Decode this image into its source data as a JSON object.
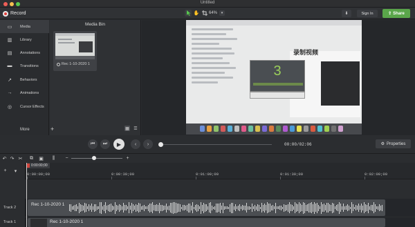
{
  "window": {
    "title": "Untitled"
  },
  "toolbar": {
    "record_label": "Record",
    "zoom_value": "64%",
    "signin_label": "Sign In",
    "share_label": "Share",
    "icons": [
      "pointer-icon",
      "hand-icon",
      "crop-icon",
      "download-icon",
      "share-icon"
    ]
  },
  "sidebar": {
    "items": [
      {
        "label": "Media",
        "icon": "media-icon",
        "active": true
      },
      {
        "label": "Library",
        "icon": "library-icon"
      },
      {
        "label": "Annotations",
        "icon": "annotations-icon"
      },
      {
        "label": "Transitions",
        "icon": "transitions-icon"
      },
      {
        "label": "Behaviors",
        "icon": "behaviors-icon"
      },
      {
        "label": "Animations",
        "icon": "animations-icon"
      },
      {
        "label": "Cursor Effects",
        "icon": "cursor-effects-icon"
      }
    ],
    "more_label": "More"
  },
  "media_bin": {
    "title": "Media Bin",
    "clip_label": "Rec 1-10-2020 1"
  },
  "preview": {
    "heading": "录制视频",
    "countdown": "3"
  },
  "playback": {
    "time": "00:00/02:06",
    "properties_label": "Properties",
    "progress": 0.0
  },
  "timeline": {
    "playhead_time": "0:00:00;00",
    "ruler_labels": [
      "0:00:00;00",
      "0:00:30;00",
      "0:01:00;00",
      "0:01:30;00",
      "0:02:00;00"
    ],
    "zoom_level": 0.45,
    "tracks": [
      {
        "name": "Track 2",
        "clip": "Rec 1-10-2020 1"
      },
      {
        "name": "Track 1",
        "clip": "Rec 1-10-2020 1"
      }
    ]
  },
  "colors": {
    "share_green": "#5aa64a",
    "record_red": "#e0403a",
    "countdown_green": "#9bd05a"
  }
}
